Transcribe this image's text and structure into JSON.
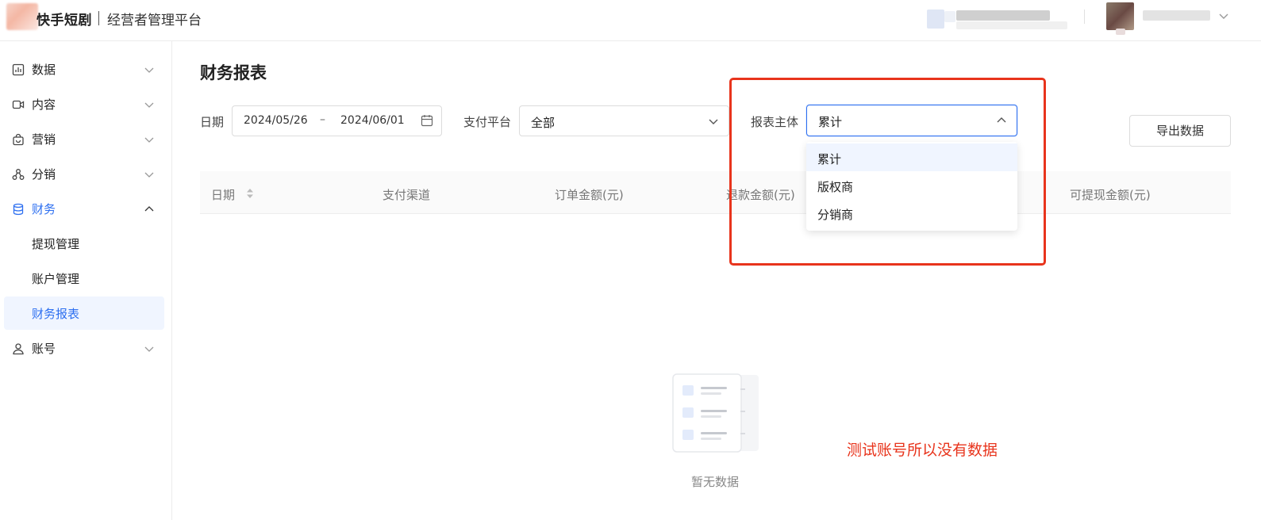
{
  "header": {
    "brand": "快手短剧",
    "subtitle": "经营者管理平台"
  },
  "sidebar": {
    "items": [
      {
        "label": "数据",
        "icon": "bar-chart-icon"
      },
      {
        "label": "内容",
        "icon": "video-icon"
      },
      {
        "label": "营销",
        "icon": "shopping-bag-icon"
      },
      {
        "label": "分销",
        "icon": "network-icon"
      },
      {
        "label": "财务",
        "icon": "database-icon",
        "expanded": true
      },
      {
        "label": "账号",
        "icon": "user-icon"
      }
    ],
    "finance_children": [
      {
        "label": "提现管理"
      },
      {
        "label": "账户管理"
      },
      {
        "label": "财务报表",
        "selected": true
      }
    ]
  },
  "main": {
    "title": "财务报表",
    "filters": {
      "date_label": "日期",
      "date_start": "2024/05/26",
      "date_sep": "–",
      "date_end": "2024/06/01",
      "platform_label": "支付平台",
      "platform_value": "全部",
      "subject_label": "报表主体",
      "subject_value": "累计"
    },
    "export_label": "导出数据",
    "table": {
      "columns": [
        "日期",
        "支付渠道",
        "订单金额(元)",
        "退款金额(元)",
        "可提现金额(元)"
      ]
    },
    "dropdown_options": [
      "累计",
      "版权商",
      "分销商"
    ],
    "empty_text": "暂无数据",
    "annotation": "测试账号所以没有数据"
  },
  "colors": {
    "accent": "#2d6ff0",
    "annotation": "#e8341c"
  }
}
